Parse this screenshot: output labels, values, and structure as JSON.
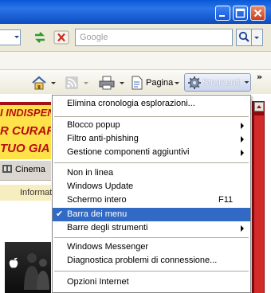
{
  "search": {
    "placeholder": "Google"
  },
  "command_bar": {
    "page_label": "Pagina",
    "tools_label": "Strumenti",
    "more_label": "»"
  },
  "webpage": {
    "banner_lines": [
      "I INDISPEN",
      "R CURARE",
      "TUO GIA"
    ],
    "cinema_label": "Cinema",
    "info_label": "Informat"
  },
  "menu": {
    "items": [
      {
        "label": "Elimina cronologia esplorazioni..."
      },
      {
        "label": "Blocco popup"
      },
      {
        "label": "Filtro anti-phishing"
      },
      {
        "label": "Gestione componenti aggiuntivi"
      },
      {
        "label": "Non in linea"
      },
      {
        "label": "Windows Update"
      },
      {
        "label": "Schermo intero",
        "shortcut": "F11"
      },
      {
        "label": "Barra dei menu",
        "checked": "✔"
      },
      {
        "label": "Barre degli strumenti"
      },
      {
        "label": "Windows Messenger"
      },
      {
        "label": "Diagnostica problemi di connessione..."
      },
      {
        "label": "Opzioni Internet"
      }
    ]
  },
  "colors": {
    "titlebar": "#0a58d6",
    "menu_highlight": "#316ac5",
    "banner": "#ffe24a",
    "banner_text": "#b80d10"
  }
}
